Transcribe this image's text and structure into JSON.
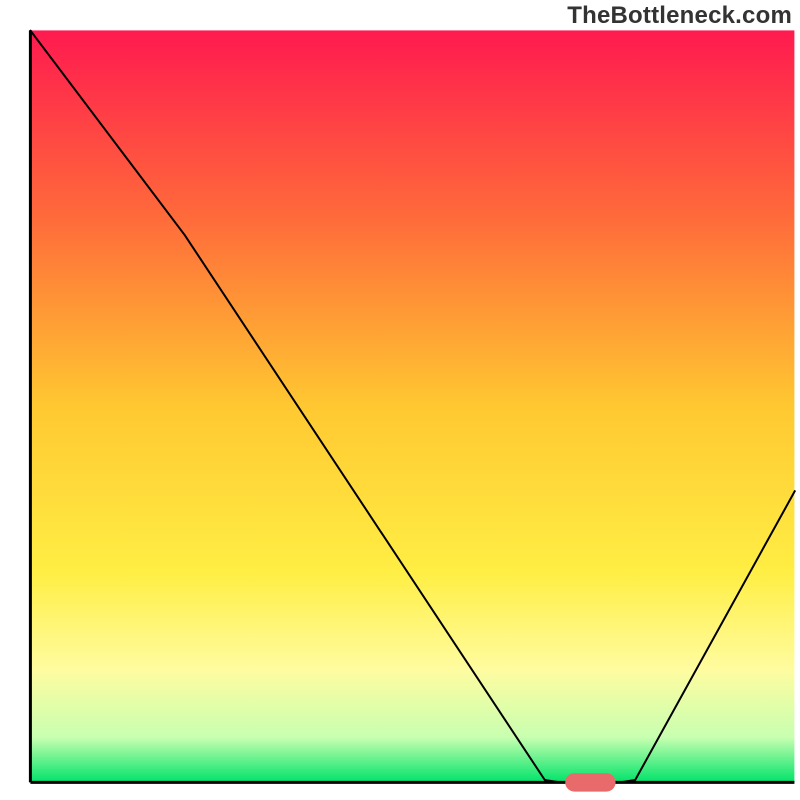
{
  "watermark": "TheBottleneck.com",
  "chart_data": {
    "type": "line",
    "title": "",
    "xlabel": "",
    "ylabel": "",
    "xlim": [
      0,
      100
    ],
    "ylim": [
      0,
      100
    ],
    "background_gradient": {
      "stops": [
        {
          "offset": 0,
          "color": "#ff1a4f"
        },
        {
          "offset": 25,
          "color": "#ff6b3a"
        },
        {
          "offset": 50,
          "color": "#ffc831"
        },
        {
          "offset": 72,
          "color": "#ffee44"
        },
        {
          "offset": 85,
          "color": "#fffca0"
        },
        {
          "offset": 94,
          "color": "#c8ffb0"
        },
        {
          "offset": 100,
          "color": "#00e36a"
        }
      ]
    },
    "axes": {
      "left_x": 3.8,
      "right_x": 99.3,
      "top_y": 3.8,
      "bottom_y": 97.8
    },
    "series": [
      {
        "name": "bottleneck-curve",
        "stroke": "#000000",
        "stroke_width": 2.0,
        "points": [
          {
            "x": 3.75,
            "y": 3.75
          },
          {
            "x": 23.1,
            "y": 29.4
          },
          {
            "x": 68.1,
            "y": 97.5
          },
          {
            "x": 70.0,
            "y": 97.8
          },
          {
            "x": 77.5,
            "y": 97.8
          },
          {
            "x": 79.4,
            "y": 97.5
          },
          {
            "x": 99.4,
            "y": 61.3
          }
        ]
      }
    ],
    "marker": {
      "name": "optimal-zone",
      "shape": "pill",
      "fill": "#e86a6a",
      "x_center": 73.8,
      "y_center": 97.8,
      "width": 6.3,
      "height": 2.3
    }
  }
}
